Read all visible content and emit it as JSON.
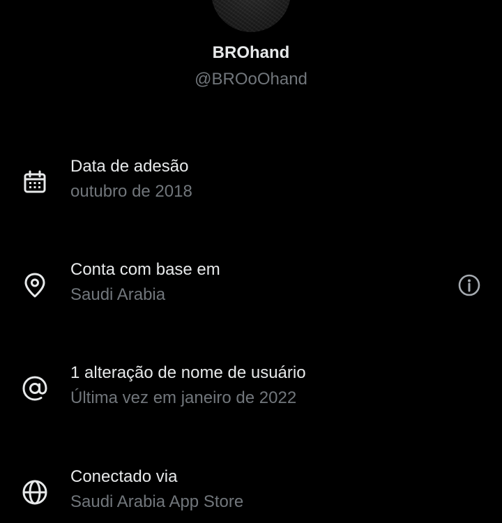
{
  "profile": {
    "display_name": "BROhand",
    "handle": "@BROoOhand"
  },
  "about": [
    {
      "icon": "calendar-icon",
      "label": "Data de adesão",
      "value": "outubro de 2018"
    },
    {
      "icon": "location-pin-icon",
      "label": "Conta com base em",
      "value": "Saudi Arabia",
      "has_info": true
    },
    {
      "icon": "at-sign-icon",
      "label": "1 alteração de nome de usuário",
      "value": "Última vez em janeiro de 2022"
    },
    {
      "icon": "globe-icon",
      "label": "Conectado via",
      "value": "Saudi Arabia App Store"
    }
  ],
  "colors": {
    "background": "#000000",
    "primary_text": "#e7e9ea",
    "secondary_text": "#71767b"
  }
}
